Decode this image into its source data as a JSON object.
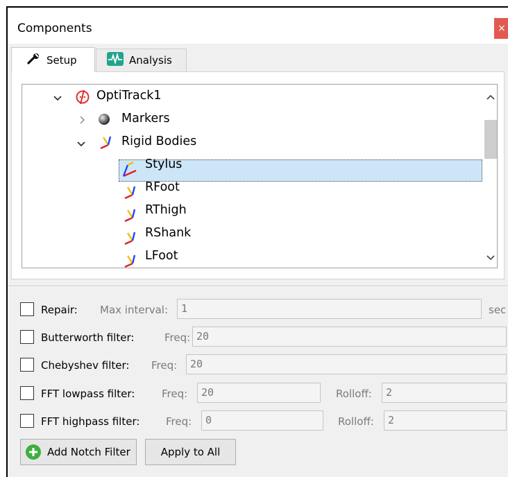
{
  "window": {
    "title": "Components",
    "close_symbol": "×"
  },
  "tabs": [
    {
      "label": "Setup",
      "icon": "wrench-icon",
      "active": true
    },
    {
      "label": "Analysis",
      "icon": "waveform-icon",
      "active": false
    }
  ],
  "tree": {
    "root": {
      "label": "OptiTrack1",
      "icon": "optitrack-icon",
      "expanded": true
    },
    "markers": {
      "label": "Markers",
      "icon": "sphere-icon",
      "expanded": false
    },
    "rigid_bodies": {
      "label": "Rigid Bodies",
      "icon": "axes-icon",
      "expanded": true
    },
    "bodies": [
      {
        "label": "Stylus",
        "selected": true
      },
      {
        "label": "RFoot",
        "selected": false
      },
      {
        "label": "RThigh",
        "selected": false
      },
      {
        "label": "RShank",
        "selected": false
      },
      {
        "label": "LFoot",
        "selected": false
      }
    ]
  },
  "filters": {
    "repair": {
      "label": "Repair:",
      "sub_label": "Max interval:",
      "value": "1",
      "unit": "sec"
    },
    "butterworth": {
      "label": "Butterworth filter:",
      "sub_label": "Freq:",
      "value": "20"
    },
    "chebyshev": {
      "label": "Chebyshev filter:",
      "sub_label": "Freq:",
      "value": "20"
    },
    "fft_lowpass": {
      "label": "FFT lowpass filter:",
      "sub_label": "Freq:",
      "value": "20",
      "rolloff_label": "Rolloff:",
      "rolloff_value": "2"
    },
    "fft_highpass": {
      "label": "FFT highpass filter:",
      "sub_label": "Freq:",
      "value": "0",
      "rolloff_label": "Rolloff:",
      "rolloff_value": "2"
    }
  },
  "buttons": {
    "add_notch": "Add Notch Filter",
    "apply_all": "Apply to All"
  },
  "colors": {
    "selection": "#cde6f7",
    "close_button": "#e25a4f",
    "add_icon": "#3fae3f"
  }
}
